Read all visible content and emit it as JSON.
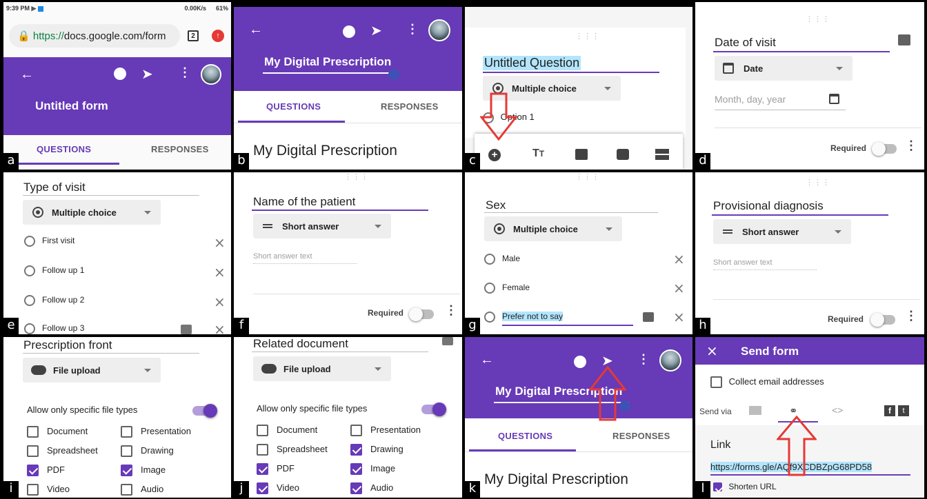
{
  "panel_a": {
    "label": "a",
    "status_time": "9:39 PM",
    "status_right": "0.00K/s",
    "battery": "61%",
    "url_secure": "https://",
    "url_rest": "docs.google.com/form",
    "tab_count": "2",
    "form_title": "Untitled form",
    "tab_questions": "QUESTIONS",
    "tab_responses": "RESPONSES"
  },
  "panel_b": {
    "label": "b",
    "form_title": "My Digital Prescription",
    "tab_questions": "QUESTIONS",
    "tab_responses": "RESPONSES",
    "heading": "My Digital Prescription"
  },
  "panel_c": {
    "label": "c",
    "question": "Untitled Question",
    "type": "Multiple choice",
    "option": "Option 1"
  },
  "panel_d": {
    "label": "d",
    "question": "Date of visit",
    "type": "Date",
    "placeholder": "Month, day, year",
    "required": "Required"
  },
  "panel_e": {
    "label": "e",
    "question": "Type of visit",
    "type": "Multiple choice",
    "options": [
      "First visit",
      "Follow up 1",
      "Follow up 2",
      "Follow up 3"
    ]
  },
  "panel_f": {
    "label": "f",
    "question": "Name of the patient",
    "type": "Short answer",
    "placeholder": "Short answer text",
    "required": "Required"
  },
  "panel_g": {
    "label": "g",
    "question": "Sex",
    "type": "Multiple choice",
    "options": [
      "Male",
      "Female",
      "Prefer not to say"
    ]
  },
  "panel_h": {
    "label": "h",
    "question": "Provisional diagnosis",
    "type": "Short answer",
    "placeholder": "Short answer text",
    "required": "Required"
  },
  "panel_i": {
    "label": "i",
    "question": "Prescription front",
    "type": "File upload",
    "allow_text": "Allow only specific file types",
    "filetypes": [
      {
        "name": "Document",
        "checked": false
      },
      {
        "name": "Presentation",
        "checked": false
      },
      {
        "name": "Spreadsheet",
        "checked": false
      },
      {
        "name": "Drawing",
        "checked": false
      },
      {
        "name": "PDF",
        "checked": true
      },
      {
        "name": "Image",
        "checked": true
      },
      {
        "name": "Video",
        "checked": false
      },
      {
        "name": "Audio",
        "checked": false
      }
    ]
  },
  "panel_j": {
    "label": "j",
    "question": "Related document",
    "type": "File upload",
    "allow_text": "Allow only specific file types",
    "filetypes": [
      {
        "name": "Document",
        "checked": false
      },
      {
        "name": "Presentation",
        "checked": false
      },
      {
        "name": "Spreadsheet",
        "checked": false
      },
      {
        "name": "Drawing",
        "checked": true
      },
      {
        "name": "PDF",
        "checked": true
      },
      {
        "name": "Image",
        "checked": true
      },
      {
        "name": "Video",
        "checked": true
      },
      {
        "name": "Audio",
        "checked": true
      }
    ]
  },
  "panel_k": {
    "label": "k",
    "form_title": "My Digital Prescription",
    "tab_questions": "QUESTIONS",
    "tab_responses": "RESPONSES",
    "heading": "My Digital Prescription"
  },
  "panel_l": {
    "label": "l",
    "title": "Send form",
    "collect_email": "Collect email addresses",
    "send_via": "Send via",
    "link_heading": "Link",
    "link_url": "https://forms.gle/AQf9XCDBZpG68PD58",
    "shorten": "Shorten URL"
  },
  "colors": {
    "primary": "#673ab7",
    "arrow": "#e53935",
    "highlight": "#b3e5fc"
  }
}
